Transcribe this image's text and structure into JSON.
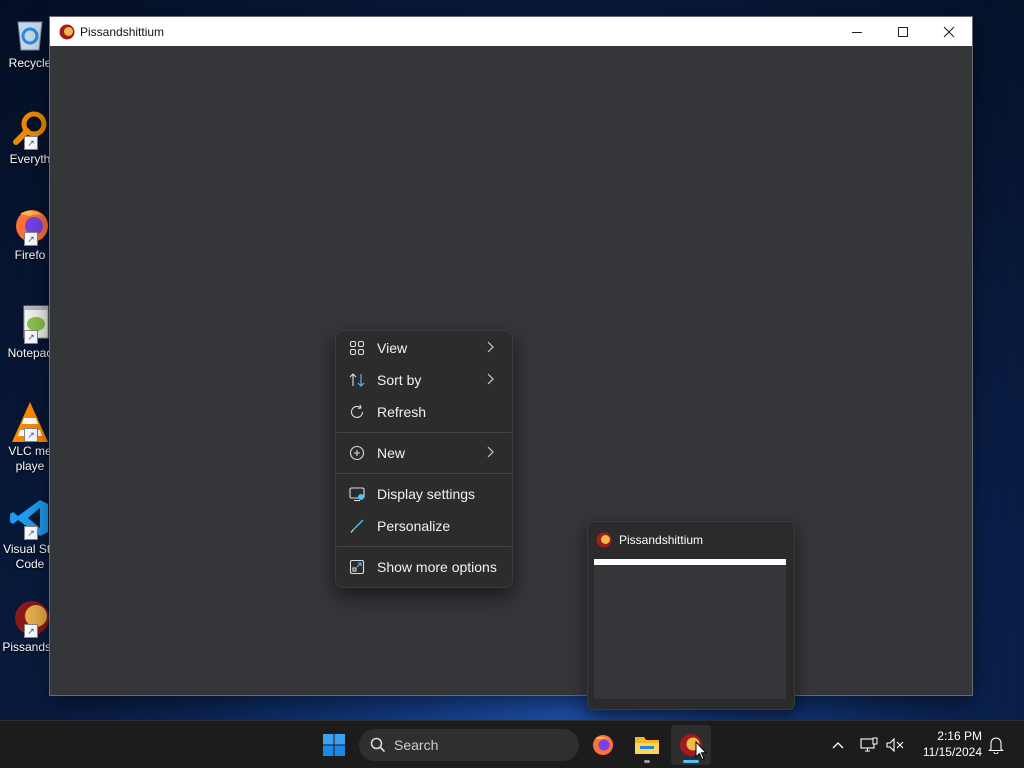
{
  "desktop": {
    "icons": [
      {
        "label": "Recycle",
        "icon": "recycle-bin-icon"
      },
      {
        "label": "Everyth",
        "icon": "everything-search-icon"
      },
      {
        "label": "Firefo",
        "icon": "firefox-icon"
      },
      {
        "label": "Notepac",
        "icon": "notepad-plus-plus-icon"
      },
      {
        "label": "VLC me\nplaye",
        "icon": "vlc-icon"
      },
      {
        "label": "Visual Stu\nCode",
        "icon": "vscode-icon"
      },
      {
        "label": "Pissandsh",
        "icon": "pissandshittium-icon"
      }
    ]
  },
  "window": {
    "title": "Pissandshittium",
    "controls": {
      "minimize": "minimize-icon",
      "maximize": "maximize-icon",
      "close": "close-icon"
    }
  },
  "context_menu": {
    "items": [
      {
        "label": "View",
        "icon": "grid-view-icon",
        "has_submenu": true
      },
      {
        "label": "Sort by",
        "icon": "sort-icon",
        "has_submenu": true
      },
      {
        "label": "Refresh",
        "icon": "refresh-icon",
        "has_submenu": false
      },
      {
        "label": "New",
        "icon": "plus-circle-icon",
        "has_submenu": true
      },
      {
        "label": "Display settings",
        "icon": "display-settings-icon",
        "has_submenu": false
      },
      {
        "label": "Personalize",
        "icon": "brush-icon",
        "has_submenu": false
      },
      {
        "label": "Show more options",
        "icon": "more-options-icon",
        "has_submenu": false
      }
    ]
  },
  "taskbar_preview": {
    "title": "Pissandshittium"
  },
  "taskbar": {
    "search_placeholder": "Search",
    "apps": [
      "start-icon",
      "firefox-icon",
      "file-explorer-icon",
      "pissandshittium-icon"
    ],
    "tray": [
      "chevron-up-icon",
      "network-icon",
      "volume-muted-icon",
      "notification-icon"
    ],
    "time": "2:16 PM",
    "date": "11/15/2024"
  },
  "colors": {
    "window_bg": "#35363a",
    "menu_bg": "#2c2c2c",
    "taskbar_bg": "#1c1c1c",
    "accent": "#4cc2ff"
  }
}
